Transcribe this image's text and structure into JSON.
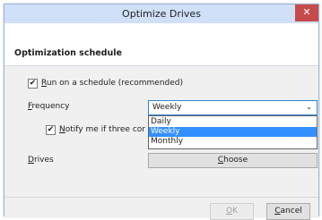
{
  "window": {
    "title": "Optimize Drives",
    "close_glyph": "✕"
  },
  "section": {
    "heading": "Optimization schedule"
  },
  "schedule": {
    "run_label_prefix": "",
    "run_label_mnemonic": "R",
    "run_label_rest": "un on a schedule (recommended)",
    "run_checked": true
  },
  "frequency": {
    "label_mnemonic": "F",
    "label_rest": "requency",
    "selected": "Weekly",
    "options": [
      "Daily",
      "Weekly",
      "Monthly"
    ],
    "highlighted_index": 1
  },
  "notify": {
    "label_mnemonic": "N",
    "label_rest": "otify me if three cor",
    "checked": true
  },
  "drives": {
    "label_mnemonic": "D",
    "label_rest": "rives",
    "choose_mnemonic": "C",
    "choose_rest": "hoose"
  },
  "buttons": {
    "ok_mnemonic": "O",
    "ok_rest": "K",
    "cancel_mnemonic": "C",
    "cancel_rest": "ancel"
  },
  "icons": {
    "checkmark": "✔",
    "dropdown": "⌄"
  },
  "colors": {
    "titlebar": "#cfe0f8",
    "close": "#c74a4a",
    "highlight": "#3390ff"
  }
}
